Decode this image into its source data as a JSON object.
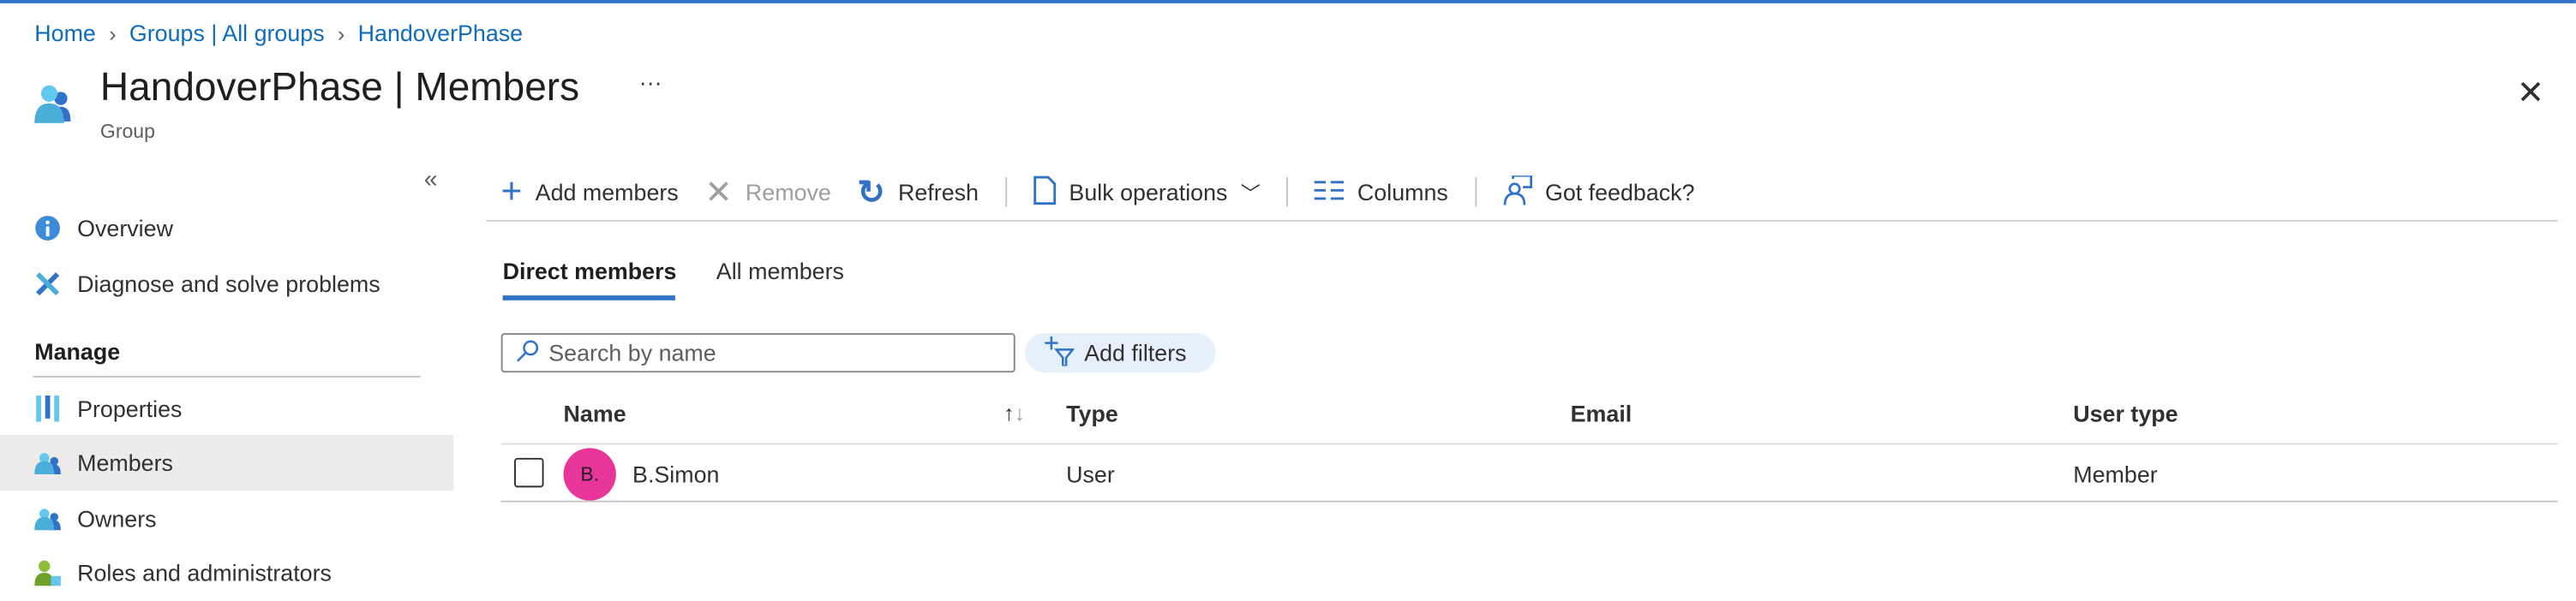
{
  "breadcrumb": [
    "Home",
    "Groups | All groups",
    "HandoverPhase"
  ],
  "header": {
    "title": "HandoverPhase | Members",
    "subtitle": "Group",
    "more": "···",
    "close": "✕"
  },
  "sidebar": {
    "collapse": "«",
    "items": [
      {
        "label": "Overview"
      },
      {
        "label": "Diagnose and solve problems"
      }
    ],
    "section": "Manage",
    "manage_items": [
      {
        "label": "Properties"
      },
      {
        "label": "Members"
      },
      {
        "label": "Owners"
      },
      {
        "label": "Roles and administrators"
      }
    ]
  },
  "toolbar": {
    "add": "Add members",
    "remove": "Remove",
    "refresh": "Refresh",
    "bulk": "Bulk operations",
    "columns": "Columns",
    "feedback": "Got feedback?"
  },
  "tabs": [
    "Direct members",
    "All members"
  ],
  "search": {
    "placeholder": "Search by name"
  },
  "filters": {
    "label": "Add filters"
  },
  "table": {
    "headers": [
      "Name",
      "Type",
      "Email",
      "User type"
    ],
    "rows": [
      {
        "initials": "B.",
        "name": "B.Simon",
        "type": "User",
        "email": "",
        "user_type": "Member"
      }
    ]
  },
  "colors": {
    "accent": "#2f72c8",
    "avatar": "#e8359a",
    "selected": "#edebe9"
  }
}
